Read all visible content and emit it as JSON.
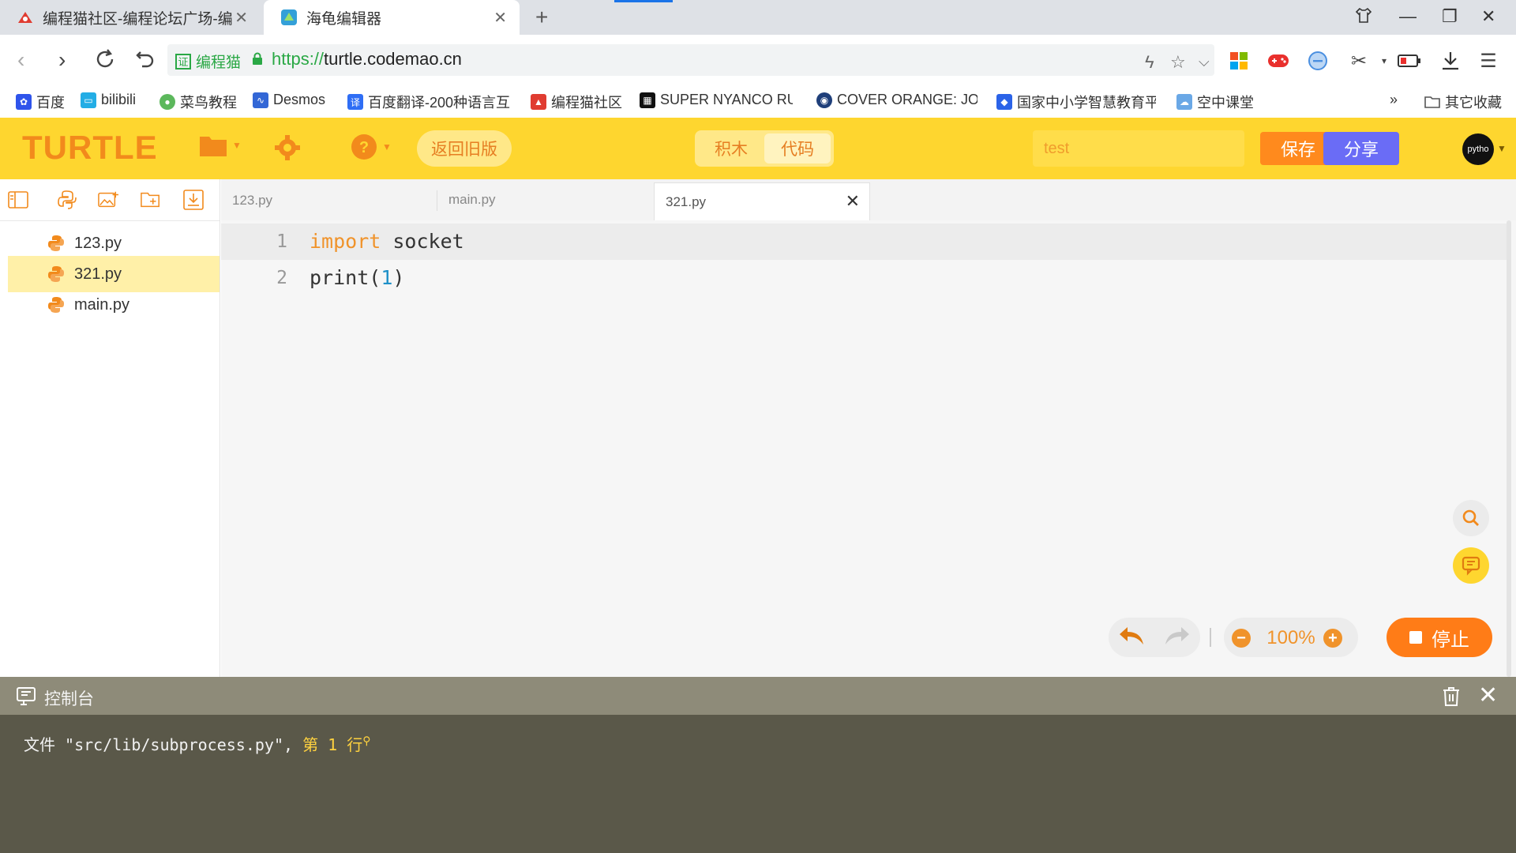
{
  "browser": {
    "tabs": [
      {
        "title": "编程猫社区-编程论坛广场-编程"
      },
      {
        "title": "海龟编辑器"
      }
    ],
    "address": {
      "cert_label": "编程猫",
      "scheme": "https://",
      "host": "turtle.codemao.cn"
    },
    "bookmarks": [
      {
        "label": "百度",
        "color": "#2f54eb"
      },
      {
        "label": "bilibili",
        "color": "#23ade5"
      },
      {
        "label": "菜鸟教程",
        "color": "#5cb85c"
      },
      {
        "label": "Desmos",
        "color": "#3367d6"
      },
      {
        "label": "百度翻译-200种语言互",
        "color": "#2f6ef5"
      },
      {
        "label": "编程猫社区",
        "color": "#e03c31"
      },
      {
        "label": "SUPER NYANCO RU",
        "color": "#111111"
      },
      {
        "label": "COVER ORANGE: JO",
        "color": "#1f3f7a"
      },
      {
        "label": "国家中小学智慧教育平",
        "color": "#2b63e8"
      },
      {
        "label": "空中课堂",
        "color": "#6aa8e6"
      }
    ],
    "bookmarks_more": "»",
    "bookmarks_other": "其它收藏"
  },
  "app": {
    "logo": "TURTLE",
    "return_old": "返回旧版",
    "modes": {
      "blocks": "积木",
      "code": "代码"
    },
    "project_name": "test",
    "save": "保存",
    "share": "分享",
    "avatar_text": "pytho"
  },
  "files": [
    {
      "name": "123.py",
      "active": false
    },
    {
      "name": "321.py",
      "active": true
    },
    {
      "name": "main.py",
      "active": false
    }
  ],
  "editor_tabs": [
    {
      "name": "123.py"
    },
    {
      "name": "main.py"
    },
    {
      "name": "321.py",
      "active": true
    }
  ],
  "code": {
    "line1_no": "1",
    "line1_kw": "import",
    "line1_rest": " socket",
    "line2_no": "2",
    "line2_fn": "print(",
    "line2_num": "1",
    "line2_end": ")"
  },
  "zoom": "100%",
  "stop": "停止",
  "console": {
    "title": "控制台",
    "line_a": "文件 \"src/lib/subprocess.py\", ",
    "line_b": "第 1 行"
  },
  "colors": {
    "accent": "#fed62f",
    "orange": "#ff8a1d",
    "purple": "#6a6cf6"
  }
}
